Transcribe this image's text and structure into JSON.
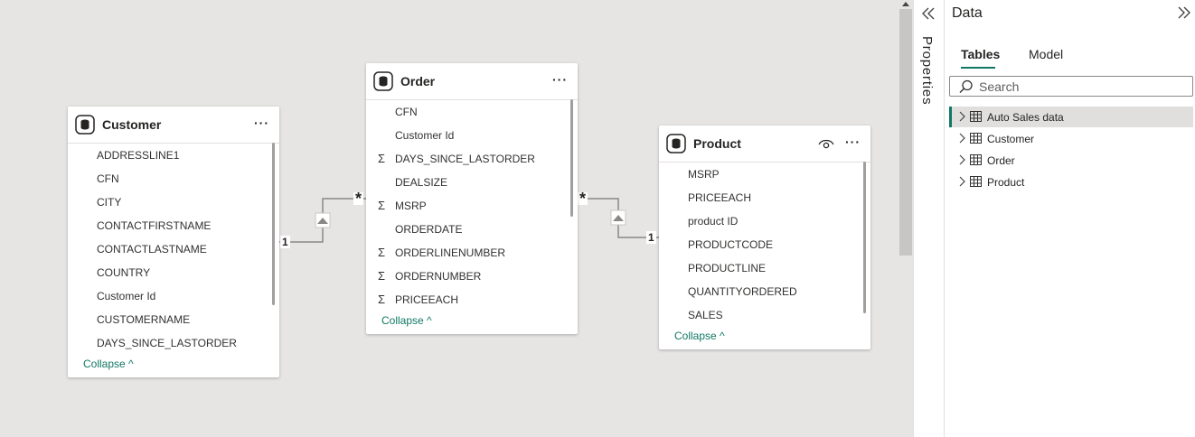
{
  "properties": {
    "label": "Properties"
  },
  "data_pane": {
    "title": "Data",
    "tabs": [
      {
        "label": "Tables",
        "active": true
      },
      {
        "label": "Model",
        "active": false
      }
    ],
    "search_placeholder": "Search",
    "tables": [
      {
        "label": "Auto Sales data",
        "selected": true
      },
      {
        "label": "Customer",
        "selected": false
      },
      {
        "label": "Order",
        "selected": false
      },
      {
        "label": "Product",
        "selected": false
      }
    ]
  },
  "cards": {
    "customer": {
      "title": "Customer",
      "fields": [
        {
          "name": "ADDRESSLINE1",
          "sum": false
        },
        {
          "name": "CFN",
          "sum": false
        },
        {
          "name": "CITY",
          "sum": false
        },
        {
          "name": "CONTACTFIRSTNAME",
          "sum": false
        },
        {
          "name": "CONTACTLASTNAME",
          "sum": false
        },
        {
          "name": "COUNTRY",
          "sum": false
        },
        {
          "name": "Customer Id",
          "sum": false
        },
        {
          "name": "CUSTOMERNAME",
          "sum": false
        },
        {
          "name": "DAYS_SINCE_LASTORDER",
          "sum": false
        }
      ],
      "collapse": "Collapse"
    },
    "order": {
      "title": "Order",
      "fields": [
        {
          "name": "CFN",
          "sum": false
        },
        {
          "name": "Customer Id",
          "sum": false
        },
        {
          "name": "DAYS_SINCE_LASTORDER",
          "sum": true
        },
        {
          "name": "DEALSIZE",
          "sum": false
        },
        {
          "name": "MSRP",
          "sum": true
        },
        {
          "name": "ORDERDATE",
          "sum": false
        },
        {
          "name": "ORDERLINENUMBER",
          "sum": true
        },
        {
          "name": "ORDERNUMBER",
          "sum": true
        },
        {
          "name": "PRICEEACH",
          "sum": true
        }
      ],
      "collapse": "Collapse"
    },
    "product": {
      "title": "Product",
      "fields": [
        {
          "name": "MSRP",
          "sum": false
        },
        {
          "name": "PRICEEACH",
          "sum": false
        },
        {
          "name": "product ID",
          "sum": false
        },
        {
          "name": "PRODUCTCODE",
          "sum": false
        },
        {
          "name": "PRODUCTLINE",
          "sum": false
        },
        {
          "name": "QUANTITYORDERED",
          "sum": false
        },
        {
          "name": "SALES",
          "sum": false
        }
      ],
      "collapse": "Collapse"
    }
  },
  "relationships": [
    {
      "from_card": "Customer",
      "from_cardinality": "1",
      "to_card": "Order",
      "to_cardinality": "*"
    },
    {
      "from_card": "Order",
      "from_cardinality": "*",
      "to_card": "Product",
      "to_cardinality": "1"
    }
  ],
  "colors": {
    "accent": "#117865",
    "canvas": "#e6e5e4"
  },
  "more_glyph": "···",
  "sigma_glyph": "Σ",
  "collapse_glyph": "^"
}
